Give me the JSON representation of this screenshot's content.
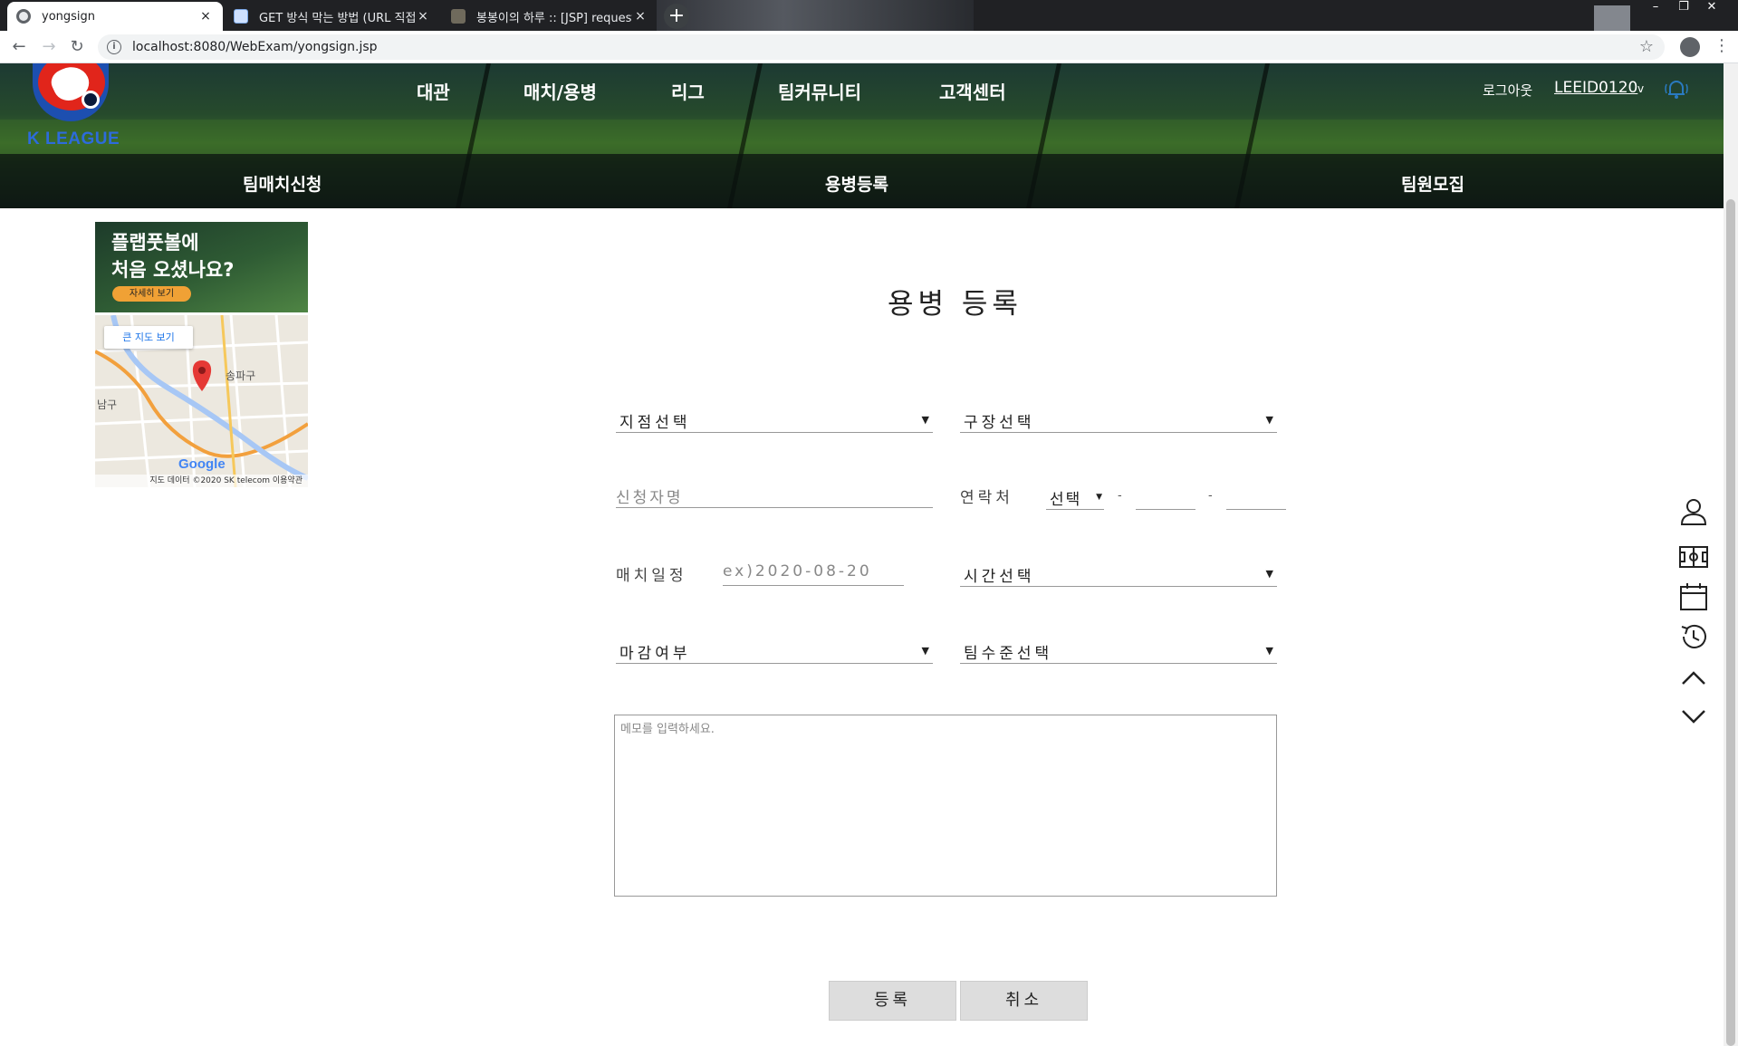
{
  "browser": {
    "tabs": [
      {
        "title": "yongsign",
        "close": "×"
      },
      {
        "title": "GET 방식 막는 방법 (URL 직접접",
        "close": "×"
      },
      {
        "title": "봉봉이의 하루 :: [JSP] request.ge",
        "close": "×"
      }
    ],
    "new_tab": "+",
    "url": "localhost:8080/WebExam/yongsign.jsp",
    "window_controls": [
      "–",
      "❐",
      "✕"
    ]
  },
  "header": {
    "logo_text": "K LEAGUE",
    "nav": [
      "대관",
      "매치/용병",
      "리그",
      "팀커뮤니티",
      "고객센터"
    ],
    "logout": "로그아웃",
    "user_id": "LEEID0120",
    "user_caret": "v",
    "subnav": [
      "팀매치신청",
      "용병등록",
      "팀원모집"
    ]
  },
  "ad": {
    "headline_1": "플랩풋볼에",
    "headline_2": "처음 오셨나요?",
    "cta": "자세히 보기"
  },
  "map": {
    "big_map": "큰 지도 보기",
    "district_1": "송파구",
    "district_2": "남구",
    "brand": "Google",
    "credits": "지도 데이터 ©2020 SK telecom  이용약관"
  },
  "form": {
    "title": "용병 등록",
    "branch_select": "지점선택",
    "field_select": "구장선택",
    "applicant_placeholder": "신청자명",
    "contact_label": "연락처",
    "phone_prefix": "선택",
    "dash": "-",
    "match_date_label": "매치일정",
    "match_date_placeholder": "ex)2020-08-20",
    "time_select": "시간선택",
    "deadline_select": "마감여부",
    "level_select": "팀수준선택",
    "memo_placeholder": "메모를 입력하세요.",
    "submit": "등록",
    "cancel": "취소",
    "caret": "▼"
  },
  "side_icons": [
    "user-icon",
    "field-icon",
    "calendar-icon",
    "history-icon",
    "chevron-up-icon",
    "chevron-down-icon"
  ],
  "colors": {
    "header_dark": "#0a120f",
    "logo_blue": "#2d6bdb",
    "logo_red": "#e1251b",
    "button_bg": "#dddddd",
    "ad_cta": "#f0a135"
  }
}
